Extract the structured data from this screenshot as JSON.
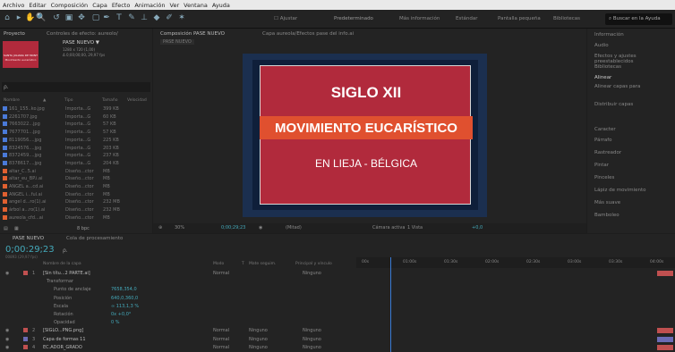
{
  "menu": [
    "Archivo",
    "Editar",
    "Composición",
    "Capa",
    "Efecto",
    "Animación",
    "Ver",
    "Ventana",
    "Ayuda"
  ],
  "workspaces": [
    "Predeterminado",
    "Más información",
    "Estándar",
    "Pantalla pequeña",
    "Bibliotecas"
  ],
  "search_placeholder": "Buscar en la Ayuda",
  "toolbar_checkbox": "Ajustar",
  "project": {
    "tab": "Proyecto",
    "effects_tab": "Controles de efecto: aureolo/",
    "selected_name": "PASE NUEVO ▼",
    "selected_info1": "1280 x 720 (1,00)",
    "selected_info2": "Δ 0;00;00;00, 29,97 fps",
    "thumb_text": "SANTA JULIANA DE MONT",
    "thumb_sub": "Movimiento eucarístico",
    "search": "ρ.",
    "cols": [
      "Nombre",
      "▲",
      "Tipo",
      "Tamaño",
      "Velocidad"
    ],
    "items": [
      {
        "name": "161_155..ko.jpg",
        "type": "Importa...G",
        "size": "399 KB",
        "color": "#4a7ad8"
      },
      {
        "name": "2261707.jpg",
        "type": "Importa...G",
        "size": "60 KB",
        "color": "#4a7ad8"
      },
      {
        "name": "7663022...jpg",
        "type": "Importa...G",
        "size": "57 KB",
        "color": "#4a7ad8"
      },
      {
        "name": "7677701...jpg",
        "type": "Importa...G",
        "size": "57 KB",
        "color": "#4a7ad8"
      },
      {
        "name": "8119056....jpg",
        "type": "Importa...G",
        "size": "225 KB",
        "color": "#4a7ad8"
      },
      {
        "name": "8324576....jpg",
        "type": "Importa...G",
        "size": "203 KB",
        "color": "#4a7ad8"
      },
      {
        "name": "8372459....jpg",
        "type": "Importa...G",
        "size": "237 KB",
        "color": "#4a7ad8"
      },
      {
        "name": "8378617....jpg",
        "type": "Importa...G",
        "size": "204 KB",
        "color": "#4a7ad8"
      },
      {
        "name": "altar_C..5.ai",
        "type": "Diseño...ctor",
        "size": "MB",
        "color": "#e06030"
      },
      {
        "name": "altar_eu_BP.i.ai",
        "type": "Diseño...ctor",
        "size": "MB",
        "color": "#e06030"
      },
      {
        "name": "ANGEL a...cd.ai",
        "type": "Diseño...ctor",
        "size": "MB",
        "color": "#e06030"
      },
      {
        "name": "ANGEL i...ful.ai",
        "type": "Diseño...ctor",
        "size": "MB",
        "color": "#e06030"
      },
      {
        "name": "angel d...ro(1).ai",
        "type": "Diseño...ctor",
        "size": "232 MB",
        "color": "#e06030"
      },
      {
        "name": "árbol a...ro(1).ai",
        "type": "Diseño...ctor",
        "size": "232 MB",
        "color": "#e06030"
      },
      {
        "name": "aureola_cfd...ai",
        "type": "Diseño...ctor",
        "size": "MB",
        "color": "#e06030"
      }
    ],
    "footer": "8 bpc"
  },
  "comp": {
    "tab": "Composición PASE NUEVO",
    "layer_tab": "Capa aureola/Efectos pase del info.ai",
    "crumb": "PASE NUEVO",
    "title1": "SIGLO XII",
    "title2": "MOVIMIENTO EUCARÍSTICO",
    "title3": "EN LIEJA - BÉLGICA",
    "zoom": "30%",
    "timecode": "0;00;29;23",
    "quality": "(Mitad)",
    "camera": "Cámara activa",
    "views": "1 Vista",
    "offset": "+0,0",
    "colors": {
      "band": "#e0502f",
      "card": "#b12a3c",
      "bg": "#0f1f3a"
    }
  },
  "right": {
    "items": [
      "Información",
      "Audio",
      "Efectos y ajustes preestablecidos",
      "Bibliotecas",
      "Alinear",
      "Alinear capas para",
      "Distribuir capas",
      "Caracter",
      "Párrafo",
      "Rastreador",
      "Pintar",
      "Pinceles",
      "Lápiz de movimiento",
      "Más suave",
      "Bamboleo"
    ]
  },
  "timeline": {
    "tabs": [
      "PASE NUEVO",
      "Cola de procesamiento"
    ],
    "timecode": "0;00:29;23",
    "timecode_sub": "00893 (29,97 fps)",
    "search": "ρ.",
    "cols": [
      "Nombre de la capa",
      "Modo",
      "T",
      "Mate seguim.",
      "Principal y vínculo"
    ],
    "ruler": [
      "00s",
      "01:00s",
      "01:30s",
      "02:00s",
      "02:30s",
      "03:00s",
      "03:30s",
      "04:00s"
    ],
    "rows": [
      {
        "num": "1",
        "name": "[Sin títu...2 PARTE.ai]",
        "mode": "Normal",
        "track": "",
        "parent": "Ninguno",
        "lab": "#c05050"
      },
      {
        "num": "",
        "name": "Transformar",
        "mode": "",
        "track": "",
        "parent": "",
        "lab": ""
      },
      {
        "num": "",
        "name": "Punto de anclaje",
        "value": "7658,354,0",
        "mode": "",
        "track": "",
        "parent": "",
        "lab": ""
      },
      {
        "num": "",
        "name": "Posición",
        "value": "640,0,360,0",
        "mode": "",
        "track": "",
        "parent": "",
        "lab": ""
      },
      {
        "num": "",
        "name": "Escala",
        "value": "∞ 113,1,3 %",
        "mode": "",
        "track": "",
        "parent": "",
        "lab": ""
      },
      {
        "num": "",
        "name": "Rotación",
        "value": "0x +0,0°",
        "mode": "",
        "track": "",
        "parent": "",
        "lab": ""
      },
      {
        "num": "",
        "name": "Opacidad",
        "value": "0 %",
        "mode": "",
        "track": "",
        "parent": "",
        "lab": ""
      },
      {
        "num": "2",
        "name": "[SIGLO...PNG.png]",
        "mode": "Normal",
        "track": "Ninguno",
        "parent": "Ninguno",
        "lab": "#c05050"
      },
      {
        "num": "3",
        "name": "Capa de formas 11",
        "mode": "Normal",
        "track": "Ninguno",
        "parent": "Ninguno",
        "lab": "#6b6bb5"
      },
      {
        "num": "4",
        "name": "EC.ADOR_GRADO",
        "mode": "Normal",
        "track": "Ninguno",
        "parent": "Ninguno",
        "lab": "#c05050"
      }
    ]
  }
}
